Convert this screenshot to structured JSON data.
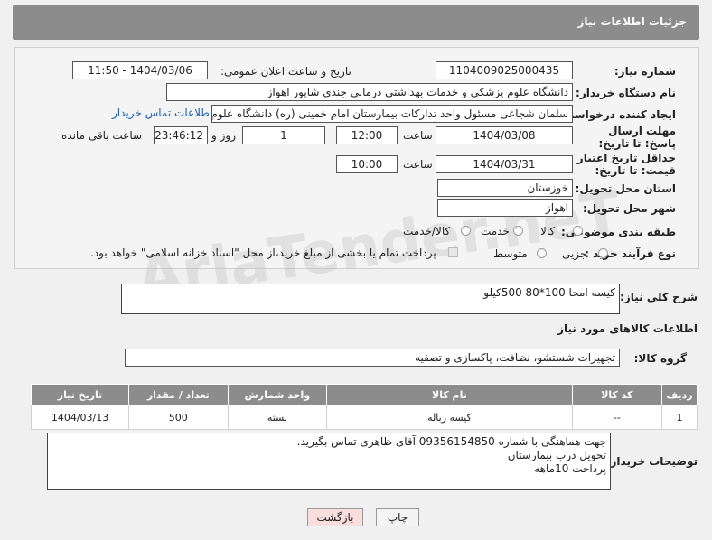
{
  "header": {
    "title": "جزئیات اطلاعات نیاز"
  },
  "form": {
    "need_number_label": "شماره نیاز:",
    "need_number": "1104009025000435",
    "announce_label": "تاریخ و ساعت اعلان عمومی:",
    "announce_value": "1404/03/06 - 11:50",
    "buyer_org_label": "نام دستگاه خریدار:",
    "buyer_org": "دانشگاه علوم پزشکی و خدمات بهداشتی درمانی جندی شاپور اهواز",
    "creator_label": "ایجاد کننده درخواست:",
    "creator": "سلمان شجاعی مسئول واحد تدارکات بیمارستان امام خمینی (ره) دانشگاه علوم پزشکی",
    "contact_link": "اطلاعات تماس خریدار",
    "reply_deadline_label": "مهلت ارسال پاسخ: تا تاریخ:",
    "reply_date": "1404/03/08",
    "time_label": "ساعت",
    "reply_time": "12:00",
    "days_value": "1",
    "days_label": "روز و",
    "remaining_time": "23:46:12",
    "remaining_label": "ساعت باقی مانده",
    "price_validity_label": "حداقل تاریخ اعتبار قیمت: تا تاریخ:",
    "price_date": "1404/03/31",
    "price_time": "10:00",
    "province_label": "استان محل تحویل:",
    "province": "خوزستان",
    "city_label": "شهر محل تحویل:",
    "city": "اهواز",
    "category_label": "طبقه بندی موضوعی:",
    "category_options": [
      "کالا",
      "خدمت",
      "کالا/خدمت"
    ],
    "process_label": "نوع فرآیند خرید :",
    "process_options": [
      "جزیی",
      "متوسط"
    ],
    "payment_note": "پرداخت تمام یا بخشی از مبلغ خرید،از محل \"اسناد خزانه اسلامی\" خواهد بود."
  },
  "summary": {
    "label": "شرح کلی نیاز:",
    "value": "کیسه امحا  100*80    500کیلو"
  },
  "goods_info_title": "اطلاعات کالاهای مورد نیاز",
  "goods_group": {
    "label": "گروه کالا:",
    "value": "تجهیزات شستشو، نظافت، پاکسازی و تصفیه"
  },
  "table": {
    "headers": [
      "ردیف",
      "کد کالا",
      "نام کالا",
      "واحد شمارش",
      "تعداد / مقدار",
      "تاریخ نیاز"
    ],
    "rows": [
      [
        "1",
        "--",
        "کیسه زباله",
        "بسته",
        "500",
        "1404/03/13"
      ]
    ]
  },
  "buyer_notes": {
    "label": "توضیحات خریدار:",
    "lines": [
      "جهت هماهنگی با شماره 09356154850 آقای ظاهری تماس بگیرید.",
      "تحویل درب بیمارستان",
      "پرداخت 10ماهه"
    ]
  },
  "buttons": {
    "print": "چاپ",
    "back": "بازگشت"
  },
  "watermark": "AriaTender.neT"
}
